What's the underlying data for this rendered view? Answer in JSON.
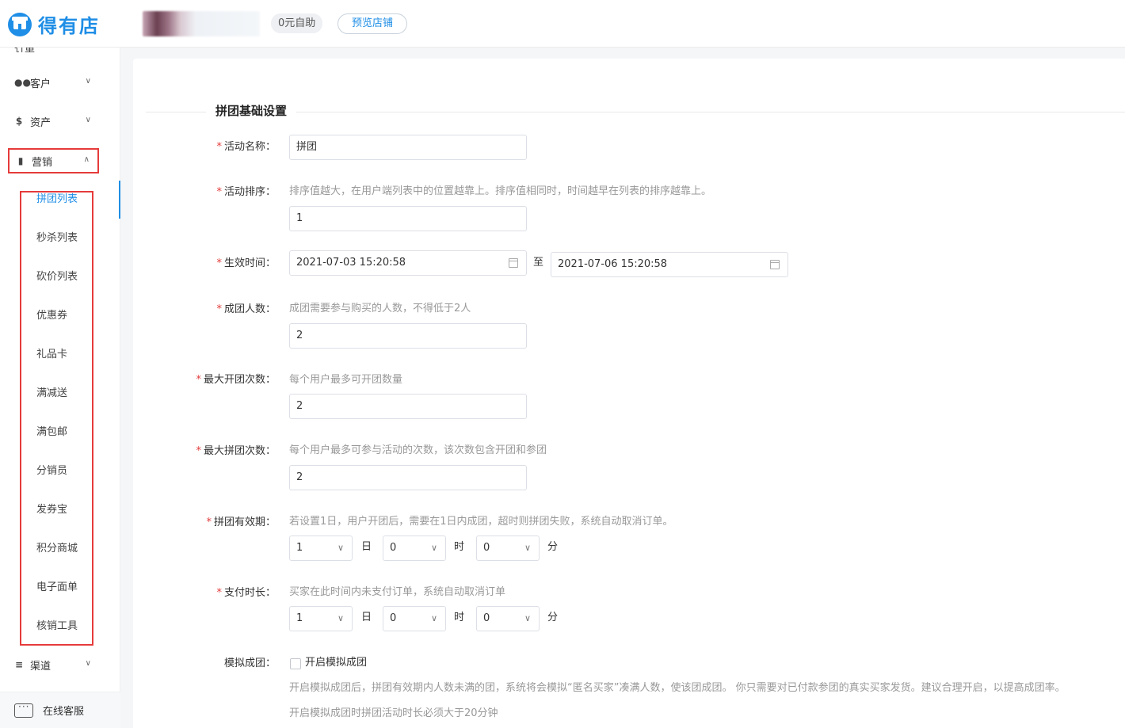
{
  "header": {
    "logo_text": "得有店",
    "plan_tag": "0元自助",
    "preview_button": "预览店铺"
  },
  "sidebar": {
    "cut_item": "订单",
    "items": [
      {
        "label": "客户",
        "icon": "users-icon"
      },
      {
        "label": "资产",
        "icon": "dollar-icon"
      },
      {
        "label": "营销",
        "icon": "bar-chart-icon"
      },
      {
        "label": "渠道",
        "icon": "layers-icon"
      }
    ],
    "marketing_sub": [
      "拼团列表",
      "秒杀列表",
      "砍价列表",
      "优惠券",
      "礼品卡",
      "满减送",
      "满包邮",
      "分销员",
      "发券宝",
      "积分商城",
      "电子面单",
      "核销工具"
    ],
    "active_sub": "拼团列表",
    "chat_label": "在线客服"
  },
  "form": {
    "section_title": "拼团基础设置",
    "activity_name": {
      "label": "活动名称：",
      "value": "拼团"
    },
    "activity_sort": {
      "label": "活动排序：",
      "hint": "排序值越大，在用户端列表中的位置越靠上。排序值相同时，时间越早在列表的排序越靠上。",
      "value": "1"
    },
    "effective_time": {
      "label": "生效时间：",
      "start": "2021-07-03 15:20:58",
      "to": "至",
      "end": "2021-07-06 15:20:58"
    },
    "group_size": {
      "label": "成团人数：",
      "hint": "成团需要参与购买的人数，不得低于2人",
      "value": "2"
    },
    "max_open": {
      "label": "最大开团次数：",
      "hint": "每个用户最多可开团数量",
      "value": "2"
    },
    "max_join": {
      "label": "最大拼团次数：",
      "hint": "每个用户最多可参与活动的次数，该次数包含开团和参团",
      "value": "2"
    },
    "validity": {
      "label": "拼团有效期：",
      "hint": "若设置1日，用户开团后，需要在1日内成团，超时则拼团失败，系统自动取消订单。",
      "day": "1",
      "hour": "0",
      "minute": "0"
    },
    "pay_time": {
      "label": "支付时长：",
      "hint": "买家在此时间内未支付订单，系统自动取消订单",
      "day": "1",
      "hour": "0",
      "minute": "0"
    },
    "units": {
      "day": "日",
      "hour": "时",
      "minute": "分"
    },
    "simulate": {
      "label": "模拟成团：",
      "checkbox_label": "开启模拟成团",
      "note1": "开启模拟成团后，拼团有效期内人数未满的团，系统将会模拟“匿名买家”凑满人数，使该团成团。 你只需要对已付款参团的真实买家发货。建议合理开启，以提高成团率。",
      "note2": "开启模拟成团时拼团活动时长必须大于20分钟"
    }
  },
  "colors": {
    "accent": "#1f8ee6",
    "required": "#e23b3b",
    "highlight_box": "#e63b3b"
  }
}
